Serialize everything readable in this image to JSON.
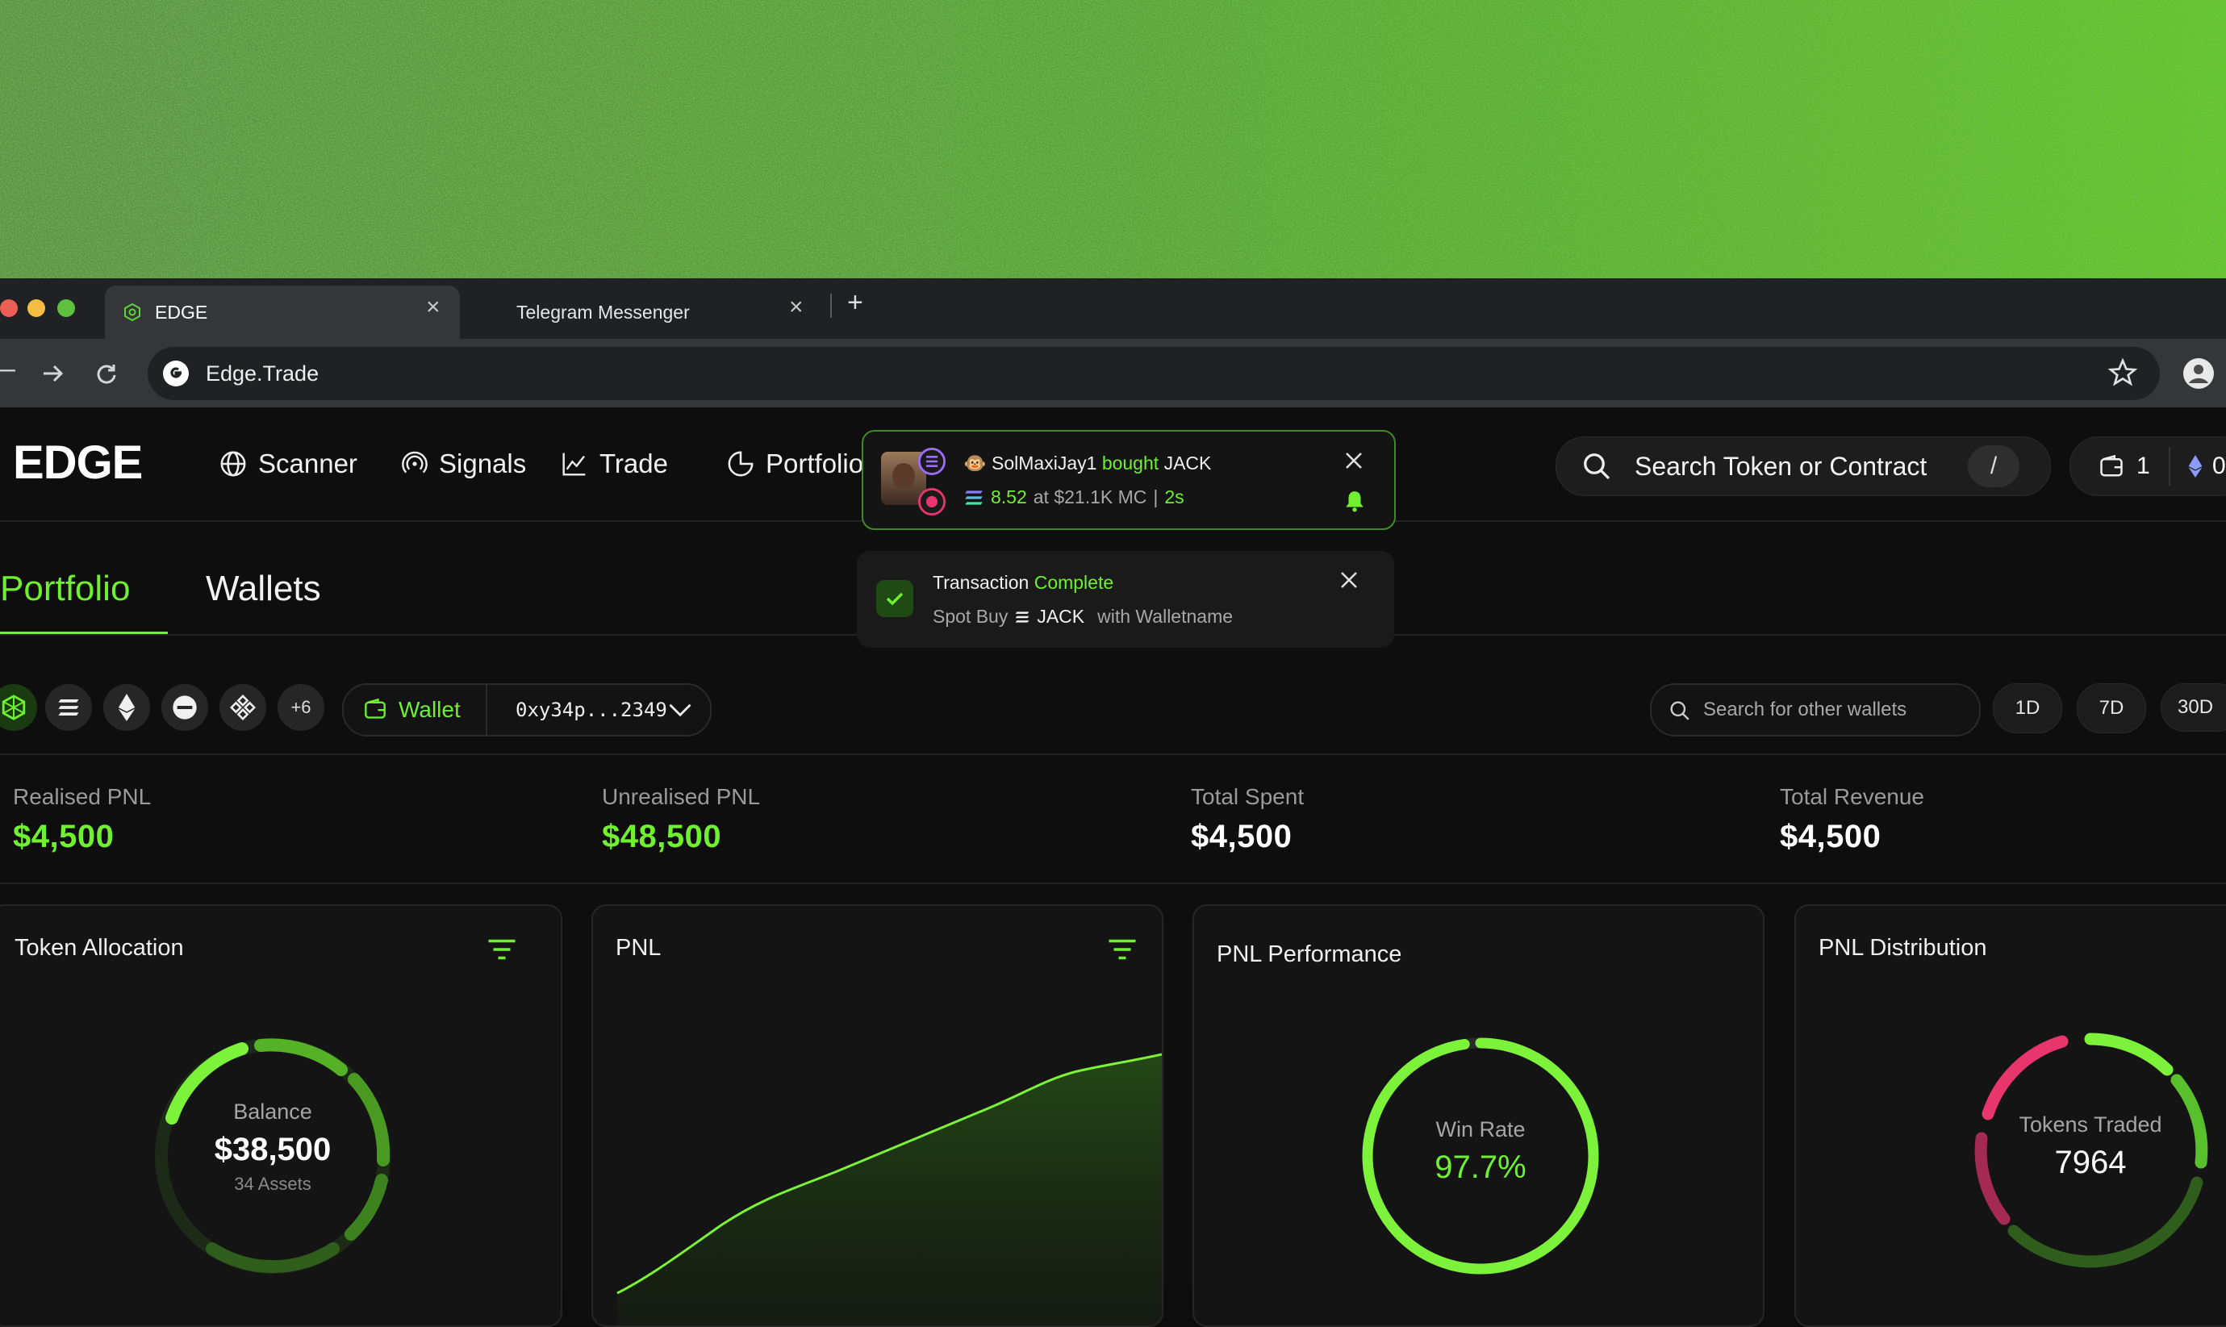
{
  "browser": {
    "tabs": [
      {
        "title": "EDGE",
        "active": true
      },
      {
        "title": "Telegram Messenger",
        "active": false
      }
    ],
    "url": "Edge.Trade",
    "new_tab_symbol": "+"
  },
  "app": {
    "logo": "EDGE",
    "nav": [
      {
        "label": "Scanner",
        "icon": "globe-icon"
      },
      {
        "label": "Signals",
        "icon": "signal-icon"
      },
      {
        "label": "Trade",
        "icon": "trade-chart-icon"
      },
      {
        "label": "Portfolio",
        "icon": "portfolio-icon"
      }
    ],
    "search": {
      "placeholder": "Search Token or Contract",
      "shortcut": "/"
    },
    "wallet_count": "1",
    "eth_badge_text": "0"
  },
  "notifications": {
    "trade": {
      "user": "SolMaxiJay1",
      "action": "bought",
      "token": "JACK",
      "amount": "8.52",
      "at_text": "at $21.1K MC",
      "separator": "|",
      "age": "2s"
    },
    "transaction": {
      "title_prefix": "Transaction",
      "title_status": "Complete",
      "detail_prefix": "Spot Buy",
      "token": "JACK",
      "detail_suffix": "with Walletname"
    }
  },
  "page_tabs": [
    {
      "label": "Portfolio",
      "active": true
    },
    {
      "label": "Wallets",
      "active": false
    }
  ],
  "filters": {
    "chains": [
      "edge-icon",
      "solana-icon",
      "ethereum-icon",
      "minus-chain-icon",
      "bnb-icon"
    ],
    "more_chains": "+6",
    "wallet_label": "Wallet",
    "wallet_address": "0xy34p...2349",
    "wallet_search_placeholder": "Search for other wallets",
    "timeframes": [
      "1D",
      "7D",
      "30D"
    ]
  },
  "stats": [
    {
      "label": "Realised PNL",
      "value": "$4,500",
      "color": "#6ff030"
    },
    {
      "label": "Unrealised PNL",
      "value": "$48,500",
      "color": "#6ff030"
    },
    {
      "label": "Total Spent",
      "value": "$4,500",
      "color": "#ffffff"
    },
    {
      "label": "Total Revenue",
      "value": "$4,500",
      "color": "#ffffff"
    }
  ],
  "cards": {
    "allocation": {
      "title": "Token Allocation",
      "center_label": "Balance",
      "center_value": "$38,500",
      "center_sub": "34 Assets"
    },
    "pnl": {
      "title": "PNL"
    },
    "performance": {
      "title": "PNL Performance",
      "center_label": "Win Rate",
      "center_value": "97.7%",
      "win_rate": 0.977
    },
    "distribution": {
      "title": "PNL Distribution",
      "center_label": "Tokens Traded",
      "center_value": "7964"
    }
  },
  "colors": {
    "accent": "#6ff030",
    "pink": "#e8356c",
    "bg": "#0e0e0e",
    "card": "#141414"
  }
}
